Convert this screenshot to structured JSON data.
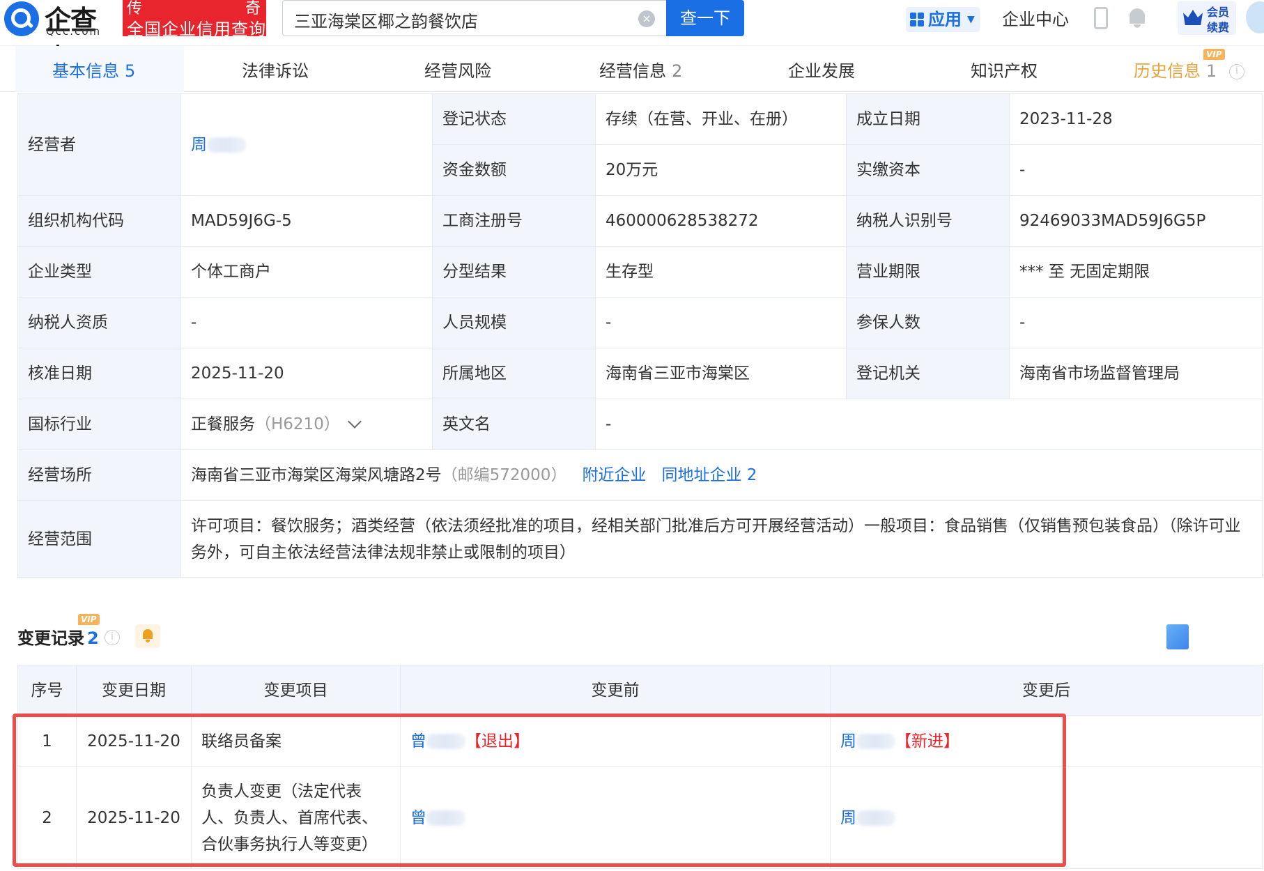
{
  "header": {
    "logo_text": "企查查",
    "logo_sub": "Qcc.com",
    "slogan_line1_left": "传",
    "slogan_line1_right": "奇",
    "slogan_line2": "全国企业信用查询",
    "search_value": "三亚海棠区椰之韵餐饮店",
    "search_clear": "×",
    "search_button": "查一下",
    "apps_label": "应用",
    "enterprise_center": "企业中心",
    "member_line1": "会员",
    "member_line2": "续费"
  },
  "tabs": [
    {
      "label": "基本信息",
      "count": "5"
    },
    {
      "label": "法律诉讼",
      "count": ""
    },
    {
      "label": "经营风险",
      "count": ""
    },
    {
      "label": "经营信息",
      "count": "2"
    },
    {
      "label": "企业发展",
      "count": ""
    },
    {
      "label": "知识产权",
      "count": ""
    },
    {
      "label": "历史信息",
      "count": "1",
      "badge": "VIP"
    }
  ],
  "info": {
    "operator_label": "经营者",
    "operator_value": "周",
    "reg_status_label": "登记状态",
    "reg_status_value": "存续（在营、开业、在册）",
    "founded_label": "成立日期",
    "founded_value": "2023-11-28",
    "capital_label": "资金数额",
    "capital_value": "20万元",
    "paid_capital_label": "实缴资本",
    "paid_capital_value": "-",
    "org_code_label": "组织机构代码",
    "org_code_value": "MAD59J6G-5",
    "biz_reg_label": "工商注册号",
    "biz_reg_value": "460000628538272",
    "taxpayer_id_label": "纳税人识别号",
    "taxpayer_id_value": "92469033MAD59J6G5P",
    "type_label": "企业类型",
    "type_value": "个体工商户",
    "class_label": "分型结果",
    "class_value": "生存型",
    "term_label": "营业期限",
    "term_value": "*** 至 无固定期限",
    "tax_qual_label": "纳税人资质",
    "tax_qual_value": "-",
    "staff_label": "人员规模",
    "staff_value": "-",
    "insured_label": "参保人数",
    "insured_value": "-",
    "approve_label": "核准日期",
    "approve_value": "2025-11-20",
    "region_label": "所属地区",
    "region_value": "海南省三亚市海棠区",
    "authority_label": "登记机关",
    "authority_value": "海南省市场监督管理局",
    "industry_label": "国标行业",
    "industry_value": "正餐服务",
    "industry_code": "（H6210）",
    "english_label": "英文名",
    "english_value": "-",
    "address_label": "经营场所",
    "address_value": "海南省三亚市海棠区海棠风塘路2号",
    "address_postcode": "（邮编572000）",
    "nearby_link": "附近企业",
    "same_addr_link": "同地址企业 2",
    "scope_label": "经营范围",
    "scope_value": "许可项目：餐饮服务；酒类经营（依法须经批准的项目，经相关部门批准后方可开展经营活动）一般项目：食品销售（仅销售预包装食品）（除许可业务外，可自主依法经营法律法规非禁止或限制的项目）"
  },
  "changes": {
    "title": "变更记录",
    "count": "2",
    "badge": "VIP",
    "columns": [
      "序号",
      "变更日期",
      "变更项目",
      "变更前",
      "变更后"
    ],
    "rows": [
      {
        "no": "1",
        "date": "2025-11-20",
        "item": "联络员备案",
        "before": "曾",
        "before_tag": "【退出】",
        "after": "周",
        "after_tag": "【新进】"
      },
      {
        "no": "2",
        "date": "2025-11-20",
        "item": "负责人变更（法定代表人、负责人、首席代表、合伙事务执行人等变更）",
        "before": "曾",
        "before_tag": "",
        "after": "周",
        "after_tag": ""
      }
    ]
  },
  "colors": {
    "brand": "#1b6fe5",
    "accent_red": "#e8242d",
    "highlight_border": "#ee4b4b",
    "label_bg": "#f2f6fc"
  }
}
